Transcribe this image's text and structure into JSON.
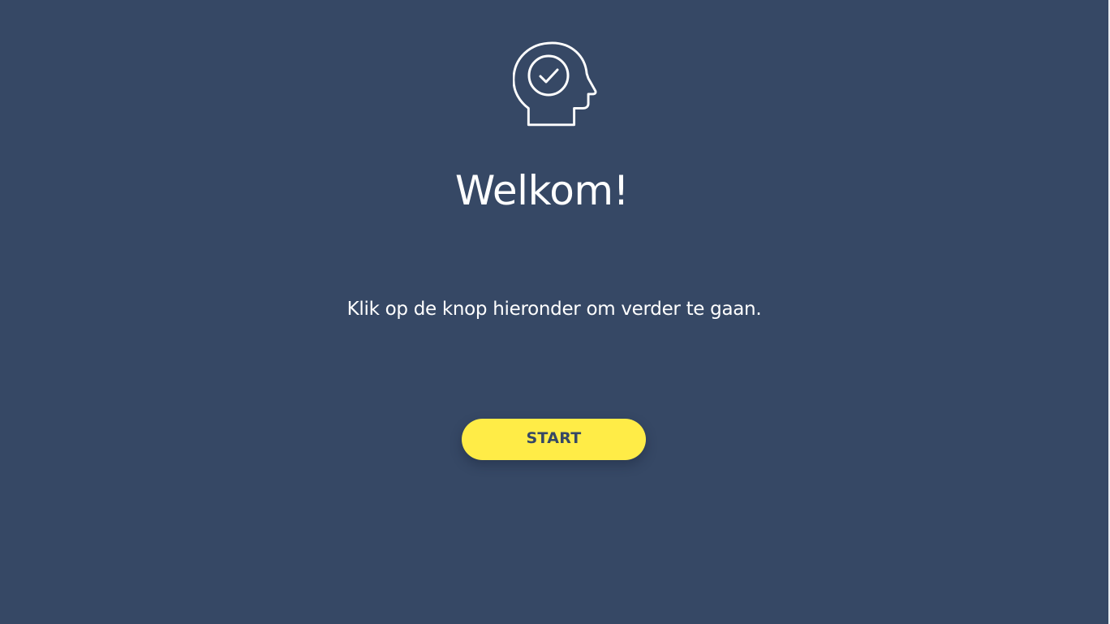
{
  "welcome": {
    "icon": "head-check-icon",
    "title": "Welkom!",
    "instruction": "Klik op de knop hieronder om verder te gaan.",
    "start_label": "START"
  },
  "colors": {
    "background": "#364865",
    "button": "#ffec47",
    "button_text": "#364865",
    "text": "#ffffff"
  }
}
